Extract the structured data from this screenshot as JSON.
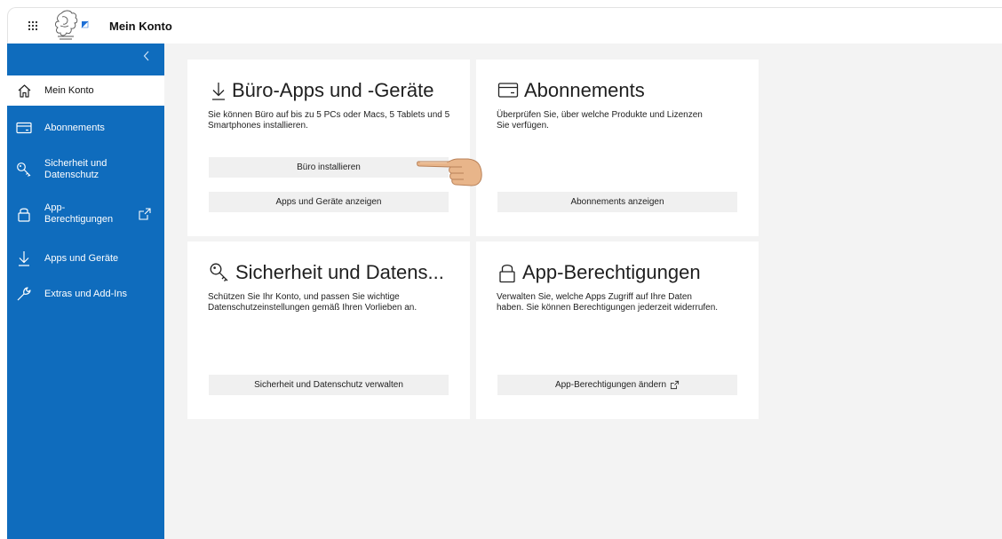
{
  "header": {
    "title": "Mein Konto",
    "waffle_icon": "waffle-icon",
    "logo": "zurich-coat-of-arms-logo"
  },
  "sidebar": {
    "background": "#0f6cbd",
    "collapse_icon": "chevron-left-icon",
    "items": [
      {
        "label": "Mein Konto",
        "icon": "home-icon",
        "active": true
      },
      {
        "label": "Abonnements",
        "icon": "card-icon"
      },
      {
        "label": "Sicherheit und Datenschutz",
        "label_line1": "Sicherheit und",
        "label_line2": "Datenschutz",
        "icon": "key-icon"
      },
      {
        "label": "App-Berechtigungen",
        "label_line1": "App-",
        "label_line2": "Berechtigungen",
        "icon": "lock-icon",
        "external_icon": "external-link-icon"
      },
      {
        "label": "Apps und Geräte",
        "icon": "download-icon"
      },
      {
        "label": "Extras und Add-Ins",
        "icon": "wrench-icon"
      }
    ]
  },
  "cards": {
    "office": {
      "title": "Büro-Apps und -Geräte",
      "icon": "download-icon",
      "description": "Sie können Büro auf bis zu 5 PCs oder Macs, 5 Tablets und 5 Smartphones installieren.",
      "install_button": "Büro installieren",
      "view_button": "Apps und Geräte anzeigen"
    },
    "subscriptions": {
      "title": "Abonnements",
      "icon": "card-icon",
      "description": "Überprüfen Sie, über welche Produkte und Lizenzen Sie verfügen.",
      "button": "Abonnements anzeigen"
    },
    "security": {
      "title": "Sicherheit und Datens...",
      "icon": "key-icon",
      "description": "Schützen Sie Ihr Konto, und passen Sie wichtige Datenschutzeinstellungen gemäß Ihren Vorlieben an.",
      "button": "Sicherheit und Datenschutz verwalten"
    },
    "permissions": {
      "title": "App-Berechtigungen",
      "icon": "lock-icon",
      "description": "Verwalten Sie, welche Apps Zugriff auf Ihre Daten haben. Sie können Berechtigungen jederzeit widerrufen.",
      "button": "App-Berechtigungen ändern",
      "button_icon": "external-link-icon"
    }
  },
  "overlay": {
    "pointer": "pointing-hand-emoji"
  }
}
